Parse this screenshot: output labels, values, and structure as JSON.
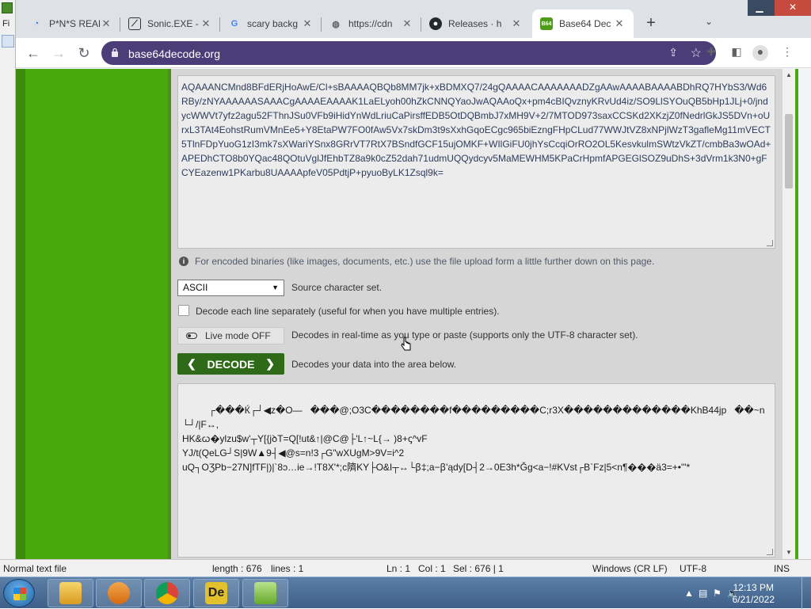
{
  "browser": {
    "tabs": [
      {
        "title": "P*N*S REAL",
        "favicon": "blue-swirl-icon"
      },
      {
        "title": "Sonic.EXE -",
        "favicon": "game-icon"
      },
      {
        "title": "scary backg",
        "favicon": "google-icon"
      },
      {
        "title": "https://cdn",
        "favicon": "globe-icon"
      },
      {
        "title": "Releases · h",
        "favicon": "github-icon"
      },
      {
        "title": "Base64 Dec",
        "favicon": "b64-icon",
        "active": true
      }
    ],
    "url": "base64decode.org"
  },
  "bg_app": {
    "menu_initial": "Fi"
  },
  "page": {
    "input_text": "AQAAANCMnd8BFdERjHoAwE/Cl+sBAAAAQBQb8MM7jk+xBDMXQ7/24gQAAAACAAAAAAADZgAAwAAAABAAAABDhRQ7HYbS3/Wd6RBy/zNYAAAAAASAAACgAAAAEAAAAK1LaELyoh00hZkCNNQYaoJwAQAAoQx+pm4cBIQvznyKRvUd4iz/SO9LlSYOuQB5bHp1JLj+0/jndycWWVt7yfz2agu52FThnJSu0VFb9iHidYnWdLriuCaPirsffEDB5OtDQBmbJ7xMH9V+2/7MTOD973saxCCSKd2XKzjZ0fNedrlGkJS5DVn+oUrxL3TAt4EohstRumVMnEe5+Y8EtaPW7FO0fAw5Vx7skDm3t9sXxhGqoECgc965biEzngFHpCLud77WWJtVZ8xNPjlWzT3gafleMg11mVECT5TlnFDpYuoG1zI3mk7sXWariYSnx8GRrVT7RtX7BSndfGCF15ujOMKF+WIlGiFU0jhYsCcqiOrRO2OL5KesvkulmSWtzVkZT/cmbBa3wOAd+APEDhCTO8b0YQac48QOtuVglJfEhbTZ8a9k0cZ52dah71udmUQQydcyv5MaMEWHM5KPaCrHpmfAPGEGlSOZ9uDhS+3dVrm1k3N0+gFCYEazenw1PKarbu8UAAAApfeV05PdtjP+pyuoByLK1Zsql9k=",
    "info_text": "For encoded binaries (like images, documents, etc.) use the file upload form a little further down on this page.",
    "charset_value": "ASCII",
    "charset_label": "Source character set.",
    "each_line_label": "Decode each line separately (useful for when you have multiple entries).",
    "live_mode_label": "Live mode OFF",
    "live_mode_desc": "Decodes in real-time as you type or paste (supports only the UTF-8 character set).",
    "decode_label": "DECODE",
    "decode_desc": "Decodes your data into the area below.",
    "output_text": "┌���Ќ┌┘◀z�O—   ���@;O3C��������f���������C;r3X�������������KhB44jp   ��~n└┘/|F↔,\nHK&ꞷ�ylzu$w'┬Y[{jꝺT=Q[!ut&↑|@C@├'L↑~L{→ )8+ꞔ^vF\nYJ/t(QeLG┘S|9W▲9┤◀@s=n!3┌G\"wXUgM>9V=i^2\nuQ┐OƷPb−27N]fTF|)|`8ɔ…ie→!T8X'*;c隮KY├O&I┬↔└ꞵ‡;a−ꞵ'ądy[D┤2→0E3h*Ğg<a−!#KVst┌B`Fz|5<n¶���ä3=+•\"'*"
  },
  "status": {
    "file_type": "Normal text file",
    "length": "length : 676",
    "lines": "lines : 1",
    "ln": "Ln : 1",
    "col": "Col : 1",
    "sel": "Sel : 676 | 1",
    "eol": "Windows (CR LF)",
    "encoding": "UTF-8",
    "mode": "INS"
  },
  "taskbar": {
    "time": "12:13 PM",
    "date": "6/21/2022",
    "apps": [
      "explorer",
      "media-player",
      "chrome",
      "de-app",
      "notepad-plus-plus"
    ]
  }
}
